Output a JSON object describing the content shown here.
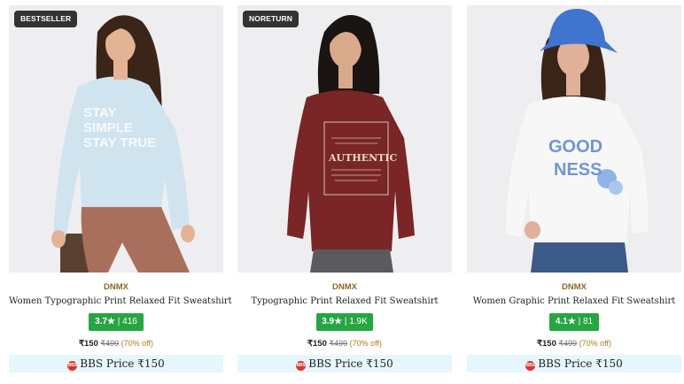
{
  "products": [
    {
      "badge": "BESTSELLER",
      "brand": "DNMX",
      "name": "Women Typographic Print Relaxed Fit Sweatshirt",
      "rating": "3.7★",
      "rating_count": "| 416",
      "price": "₹150",
      "mrp": "₹499",
      "discount": "(70% off)",
      "bbs_label": "BBS Price ₹150",
      "print_text": [
        "STAY",
        "SIMPLE",
        "STAY TRUE"
      ],
      "colors": {
        "bg": "#eeeef0",
        "top": "#cfe4ee",
        "bottom": "#a8705c",
        "hair": "#3b2418",
        "skin": "#e3b396"
      }
    },
    {
      "badge": "NORETURN",
      "brand": "DNMX",
      "name": "Typographic Print Relaxed Fit Sweatshirt",
      "rating": "3.9★",
      "rating_count": "| 1.9K",
      "price": "₹150",
      "mrp": "₹499",
      "discount": "(70% off)",
      "bbs_label": "BBS Price ₹150",
      "print_text": [
        "AUTHENTIC"
      ],
      "colors": {
        "bg": "#eeeef0",
        "top": "#7a2626",
        "bottom": "#5b5b5d",
        "hair": "#1a1412",
        "skin": "#d9a98c"
      }
    },
    {
      "badge": "",
      "brand": "DNMX",
      "name": "Women Graphic Print Relaxed Fit Sweatshirt",
      "rating": "4.1★",
      "rating_count": "| 81",
      "price": "₹150",
      "mrp": "₹499",
      "discount": "(70% off)",
      "bbs_label": "BBS Price ₹150",
      "print_text": [
        "GOOD",
        "NESS"
      ],
      "colors": {
        "bg": "#eeeef0",
        "top": "#f7f7f8",
        "bottom": "#3c5a86",
        "hair": "#3a2418",
        "skin": "#e0b09a",
        "hat": "#3f74cf"
      }
    }
  ],
  "bbs_icon_text": "BBS",
  "colors": {
    "rating_bg": "#26a543",
    "brand": "#8a6a2a",
    "bbs_bg": "#e6f6fd",
    "discount": "#b07a1a"
  }
}
